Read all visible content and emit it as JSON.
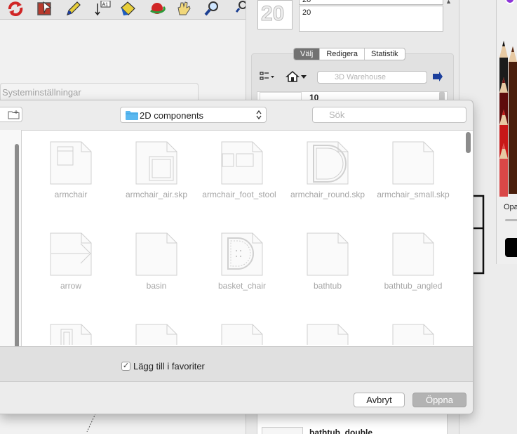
{
  "toolbar": {
    "icons": [
      "rotate-icon",
      "select-icon",
      "pencil-icon",
      "text-icon",
      "paint-icon",
      "orbit-icon",
      "pan-icon",
      "zoom-icon"
    ],
    "text_tool_label": "A1"
  },
  "background_panel": {
    "title": "Systeminställningar"
  },
  "components_panel": {
    "name_value": "20",
    "description_value": "20",
    "thumbnail_text": "20",
    "tabs": [
      {
        "label": "Välj",
        "active": true
      },
      {
        "label": "Redigera",
        "active": false
      },
      {
        "label": "Statistik",
        "active": false
      }
    ],
    "warehouse_search_placeholder": "3D Warehouse",
    "list": [
      {
        "label": "10"
      },
      {
        "label": "bathtub_double"
      }
    ]
  },
  "colors_panel": {
    "opacity_label": "Opacitet",
    "swatch_color": "#000000"
  },
  "dialog": {
    "location": "2D components",
    "search_placeholder": "Sök",
    "files": [
      {
        "label": "armchair"
      },
      {
        "label": "armchair_air.skp"
      },
      {
        "label": "armchair_foot_stool"
      },
      {
        "label": "armchair_round.skp"
      },
      {
        "label": "armchair_small.skp"
      },
      {
        "label": "arrow"
      },
      {
        "label": "basin"
      },
      {
        "label": "basket_chair"
      },
      {
        "label": "bathtub"
      },
      {
        "label": "bathtub_angled"
      }
    ],
    "add_to_favorites_label": "Lägg till i favoriter",
    "add_to_favorites_checked": true,
    "cancel_label": "Avbryt",
    "open_label": "Öppna"
  }
}
